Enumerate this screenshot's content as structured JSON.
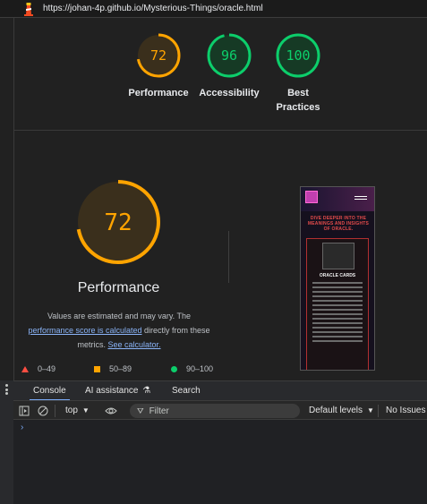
{
  "url_bar": {
    "url": "https://johan-4p.github.io/Mysterious-Things/oracle.html",
    "icon": "lighthouse-icon"
  },
  "gauges": [
    {
      "label": "Performance",
      "score": 72,
      "color": "#ffa400"
    },
    {
      "label": "Accessibility",
      "score": 96,
      "color": "#0cce6b"
    },
    {
      "label": "Best Practices",
      "score": 100,
      "color": "#0cce6b"
    }
  ],
  "main": {
    "score": 72,
    "score_color": "#ffa400",
    "title": "Performance",
    "note_prefix": "Values are estimated and may vary. The",
    "note_link": "performance score is calculated",
    "note_middle": " directly from these metrics. ",
    "note_calc_link": "See calculator."
  },
  "thumbnail": {
    "heading": "DIVE DEEPER INTO THE MEANINGS AND INSIGHTS OF ORACLE.",
    "card_title": "ORACLE CARDS"
  },
  "legend": [
    {
      "label": "0–49",
      "color": "#ff4e42",
      "shape": "triangle"
    },
    {
      "label": "50–89",
      "color": "#ffa400",
      "shape": "square"
    },
    {
      "label": "90–100",
      "color": "#0cce6b",
      "shape": "circle"
    }
  ],
  "drawer": {
    "tabs": [
      "Console",
      "AI assistance",
      "Search"
    ],
    "active_tab": "Console",
    "context": "top",
    "filter_placeholder": "Filter",
    "levels": "Default levels",
    "issues": "No Issues"
  }
}
